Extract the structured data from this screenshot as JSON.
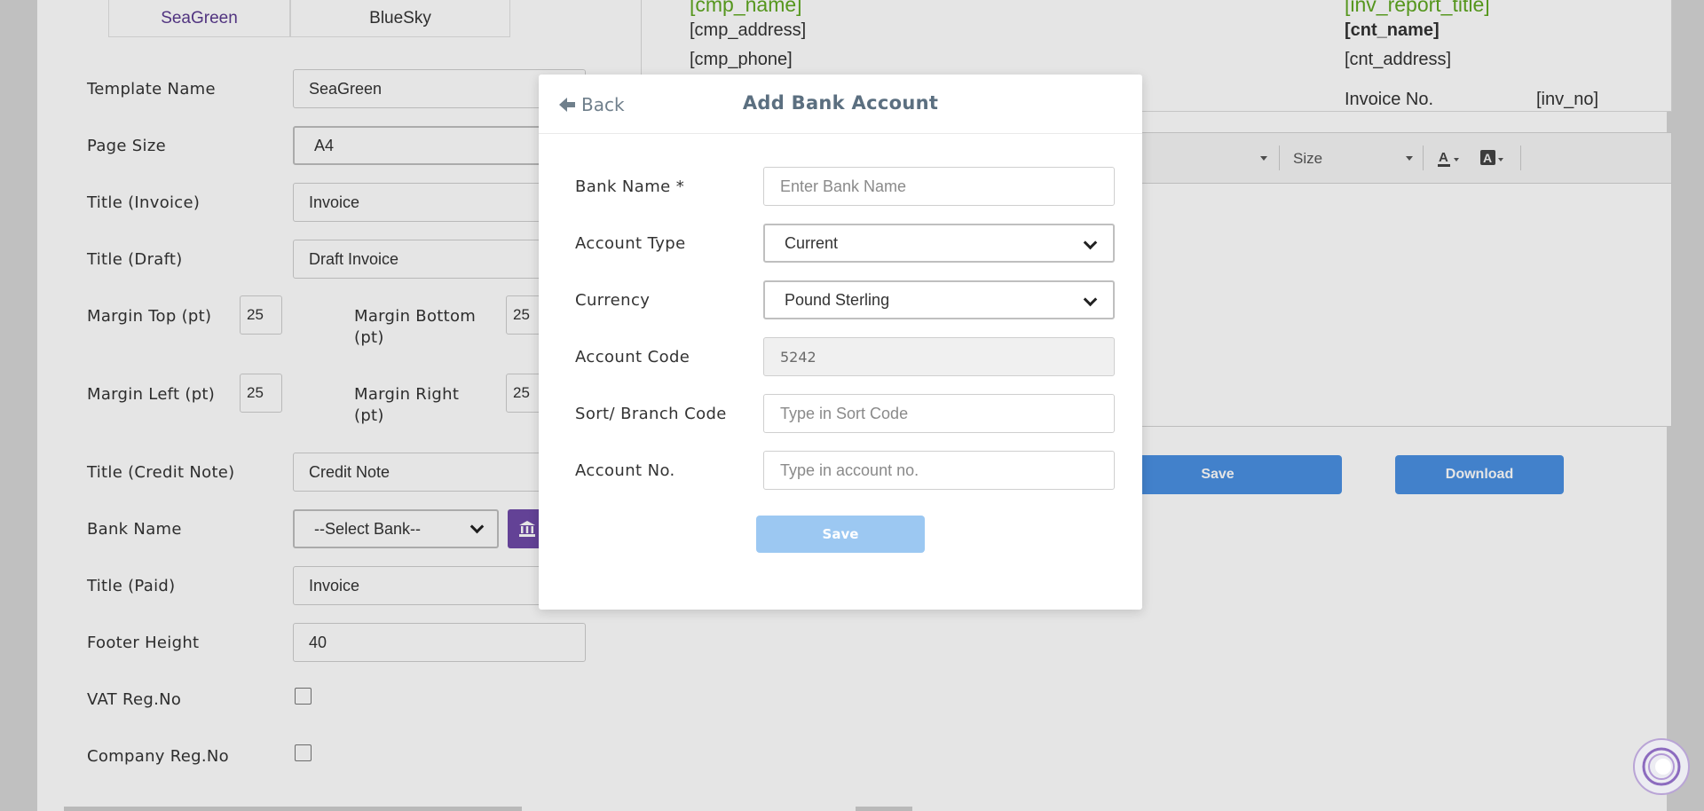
{
  "template_tabs": [
    "SeaGreen",
    "BlueSky"
  ],
  "form": {
    "template_name": {
      "label": "Template Name",
      "value": "SeaGreen"
    },
    "page_size": {
      "label": "Page Size",
      "value": "A4"
    },
    "title_invoice": {
      "label": "Title (Invoice)",
      "value": "Invoice"
    },
    "title_draft": {
      "label": "Title (Draft)",
      "value": "Draft Invoice"
    },
    "margin_top": {
      "label": "Margin Top (pt)",
      "value": "25"
    },
    "margin_bottom": {
      "label_line1": "Margin Bottom",
      "label_line2": "(pt)",
      "value": "25"
    },
    "margin_left": {
      "label": "Margin Left (pt)",
      "value": "25"
    },
    "margin_right": {
      "label_line1": "Margin Right",
      "label_line2": "(pt)",
      "value": "25"
    },
    "title_credit": {
      "label": "Title (Credit Note)",
      "value": "Credit Note"
    },
    "bank_name": {
      "label": "Bank Name",
      "value": "--Select Bank--"
    },
    "title_paid": {
      "label": "Title (Paid)",
      "value": "Invoice"
    },
    "footer_height": {
      "label": "Footer Height",
      "value": "40"
    },
    "vat_reg": {
      "label": "VAT Reg.No"
    },
    "company_reg": {
      "label": "Company Reg.No"
    }
  },
  "preview": {
    "cmp_name": "[cmp_name]",
    "cmp_address": "[cmp_address]",
    "cmp_phone": "[cmp_phone]",
    "inv_report_title": "[inv_report_title]",
    "cnt_name": "[cnt_name]",
    "cnt_address": "[cnt_address]",
    "invoice_no_label": "Invoice No.",
    "inv_no": "[inv_no]"
  },
  "editor_toolbar": {
    "size_label": "Size"
  },
  "actions": {
    "save": "Save",
    "download": "Download"
  },
  "modal": {
    "back_label": "Back",
    "title": "Add Bank Account",
    "bank_name": {
      "label": "Bank Name *",
      "placeholder": "Enter Bank Name"
    },
    "account_type": {
      "label": "Account Type",
      "value": "Current"
    },
    "currency": {
      "label": "Currency",
      "value": "Pound Sterling"
    },
    "account_code": {
      "label": "Account Code",
      "value": "5242"
    },
    "sort_code": {
      "label": "Sort/ Branch Code",
      "placeholder": "Type in Sort Code"
    },
    "account_no": {
      "label": "Account No.",
      "placeholder": "Type in account no."
    },
    "save_label": "Save"
  },
  "colors": {
    "accent_purple": "#6f4aa8",
    "preview_green": "#5fa821",
    "primary_blue": "#4a90e2",
    "disabled_blue": "#9cc8f2"
  }
}
